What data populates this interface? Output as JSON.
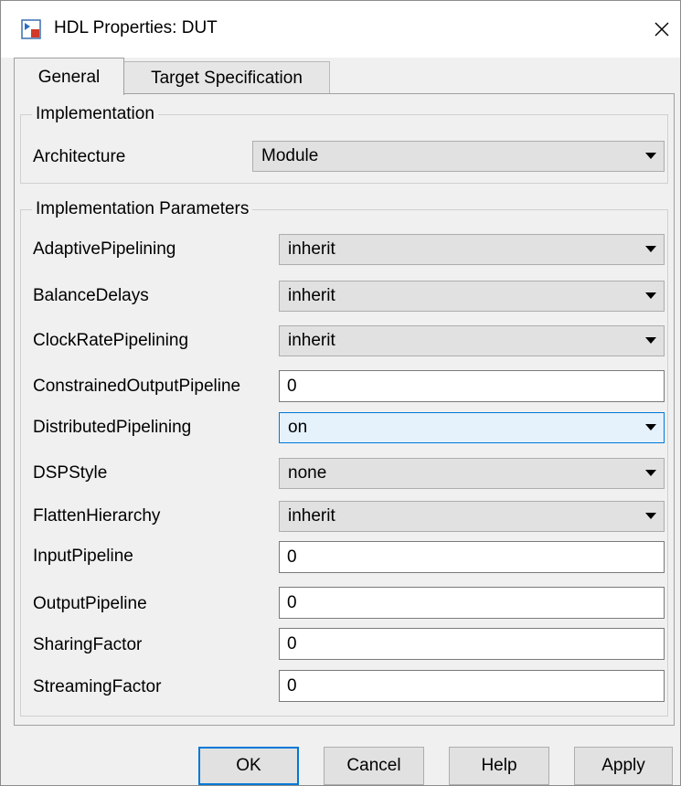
{
  "window": {
    "title": "HDL Properties: DUT",
    "icon": "simulink-block-icon",
    "close_icon": "close-icon"
  },
  "tabs": [
    {
      "label": "General",
      "active": true
    },
    {
      "label": "Target Specification",
      "active": false
    }
  ],
  "implementation": {
    "legend": "Implementation",
    "architecture_label": "Architecture",
    "architecture_value": "Module"
  },
  "parameters": {
    "legend": "Implementation Parameters",
    "rows": [
      {
        "label": "AdaptivePipelining",
        "kind": "select",
        "value": "inherit"
      },
      {
        "label": "BalanceDelays",
        "kind": "select",
        "value": "inherit"
      },
      {
        "label": "ClockRatePipelining",
        "kind": "select",
        "value": "inherit"
      },
      {
        "label": "ConstrainedOutputPipeline",
        "kind": "text",
        "value": "0"
      },
      {
        "label": "DistributedPipelining",
        "kind": "select",
        "value": "on"
      },
      {
        "label": "DSPStyle",
        "kind": "select",
        "value": "none"
      },
      {
        "label": "FlattenHierarchy",
        "kind": "select",
        "value": "inherit"
      },
      {
        "label": "InputPipeline",
        "kind": "text",
        "value": "0"
      },
      {
        "label": "OutputPipeline",
        "kind": "text",
        "value": "0"
      },
      {
        "label": "SharingFactor",
        "kind": "text",
        "value": "0"
      },
      {
        "label": "StreamingFactor",
        "kind": "text",
        "value": "0"
      }
    ]
  },
  "buttons": {
    "ok": "OK",
    "cancel": "Cancel",
    "help": "Help",
    "apply": "Apply"
  },
  "colors": {
    "focus_accent": "#0078d7",
    "hover_background": "#e5f1fb",
    "dialog_background": "#f0f0f0"
  }
}
